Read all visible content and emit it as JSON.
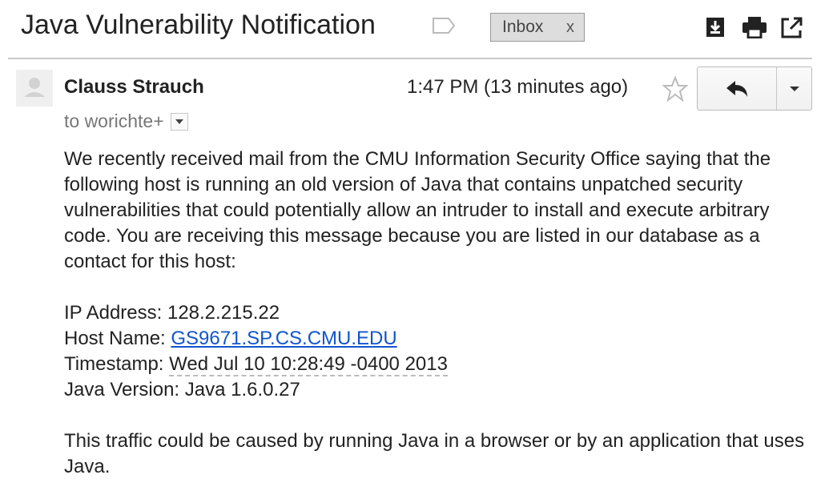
{
  "subject": "Java Vulnerability Notification",
  "label_chip": {
    "text": "Inbox",
    "remove": "x"
  },
  "header_icons": [
    "download-icon",
    "print-icon",
    "open-in-new-icon"
  ],
  "sender": {
    "name": "Clauss Strauch",
    "recipient": "to worichte+"
  },
  "time": "1:47 PM (13 minutes ago)",
  "message": {
    "paragraph1": "We recently received mail from the CMU Information Security Office saying that the following host is running an old version of Java that contains unpatched security vulnerabilities that could potentially allow an intruder to install and execute arbitrary code. You are receiving this message because you are listed in our database as a contact for this host:",
    "ip_label": "IP Address: ",
    "ip_value": "128.2.215.22",
    "host_label": "Host Name: ",
    "host_value": "GS9671.SP.CS.CMU.EDU",
    "timestamp_label": "Timestamp: ",
    "timestamp_value": "Wed Jul 10 10:28:49 -0400 2013",
    "java_label": "Java Version: ",
    "java_value": "Java 1.6.0.27",
    "paragraph2": "This traffic could be caused by running Java in a browser or by an application that uses Java."
  },
  "colors": {
    "link": "#1155cc",
    "chip_bg": "#dddddd",
    "muted": "#777777"
  }
}
